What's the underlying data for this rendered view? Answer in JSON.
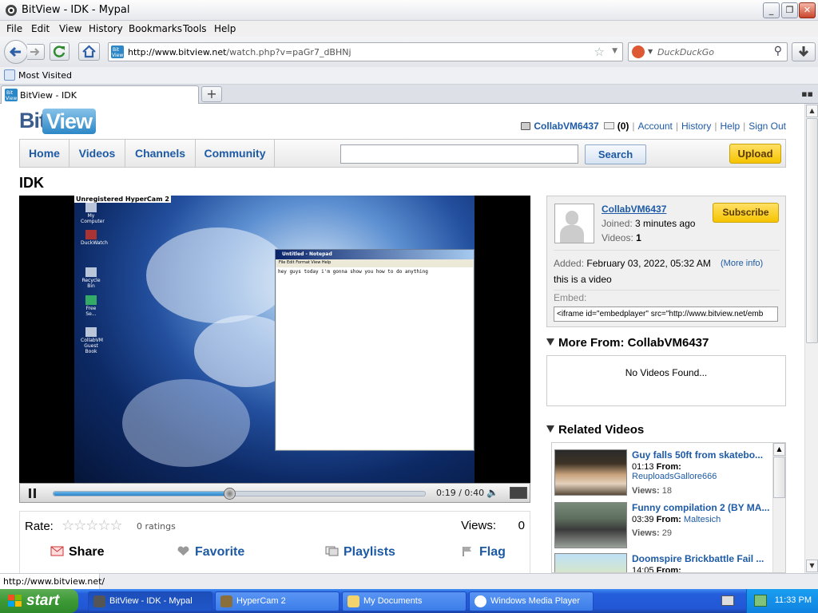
{
  "window": {
    "title": "BitView - IDK - Mypal",
    "minimize": "_",
    "maximize": "❐",
    "close": "✕"
  },
  "menu": [
    "File",
    "Edit",
    "View",
    "History",
    "Bookmarks",
    "Tools",
    "Help"
  ],
  "toolbar": {
    "url_host": "http://www.bitview.net",
    "url_path": "/watch.php?v=paGr7_dBHNj",
    "search_placeholder": "DuckDuckGo"
  },
  "bookmarks": {
    "most_visited": "Most Visited"
  },
  "tabs": [
    {
      "title": "BitView - IDK"
    }
  ],
  "site": {
    "logo_bit": "Bit",
    "logo_view": "View",
    "user": "CollabVM6437",
    "mail_count": "(0)",
    "links": [
      "Account",
      "History",
      "Help",
      "Sign Out"
    ],
    "nav": [
      "Home",
      "Videos",
      "Channels",
      "Community"
    ],
    "search_button": "Search",
    "upload_button": "Upload"
  },
  "video": {
    "title": "IDK",
    "hypercam_watermark": "Unregistered HyperCam 2",
    "desktop_icons": [
      "My Computer",
      "DuckWatch",
      "Recycle Bin",
      "Free Se...",
      "CollabVM Guest Book"
    ],
    "notepad_title": "Untitled - Notepad",
    "notepad_menu": "File   Edit   Format   View   Help",
    "notepad_text": "hey guys today i'm gonna show you how to do anything",
    "time": "0:19 / 0:40",
    "progress": 0.475,
    "rate_label": "Rate:",
    "stars": "☆☆☆☆☆",
    "ratings": "0 ratings",
    "views_label": "Views:",
    "views": "0",
    "actions": {
      "share": "Share",
      "favorite": "Favorite",
      "playlists": "Playlists",
      "flag": "Flag"
    }
  },
  "uploader": {
    "name": "CollabVM6437",
    "joined_label": "Joined:",
    "joined": "3 minutes ago",
    "videos_label": "Videos:",
    "videos": "1",
    "subscribe": "Subscribe",
    "added_label": "Added:",
    "added": "February 03, 2022, 05:32 AM",
    "more_info": "(More info)",
    "description": "this is a video",
    "embed_label": "Embed:",
    "embed_code": "<iframe id=\"embedplayer\" src=\"http://www.bitview.net/emb"
  },
  "more_from": {
    "heading": "More From: CollabVM6437",
    "empty": "No Videos Found..."
  },
  "related": {
    "heading": "Related Videos",
    "from_label": "From:",
    "views_label": "Views:",
    "items": [
      {
        "title": "Guy falls 50ft from skatebo...",
        "duration": "01:13",
        "author": "ReuploadsGallore666",
        "views": "18"
      },
      {
        "title": "Funny compilation 2 (BY MA...",
        "duration": "03:39",
        "author": "Maltesich",
        "views": "29"
      },
      {
        "title": "Doomspire Brickbattle Fail ...",
        "duration": "14:05",
        "author": "",
        "views": ""
      }
    ]
  },
  "status": {
    "text": "http://www.bitview.net/"
  },
  "taskbar": {
    "start": "start",
    "items": [
      "BitView - IDK - Mypal",
      "HyperCam 2",
      "My Documents",
      "Windows Media Player"
    ],
    "clock": "11:33 PM"
  },
  "colors": {
    "link": "#1d5aa6",
    "upload": "#f6c400",
    "taskbar": "#245edb",
    "start": "#3c9a36"
  }
}
